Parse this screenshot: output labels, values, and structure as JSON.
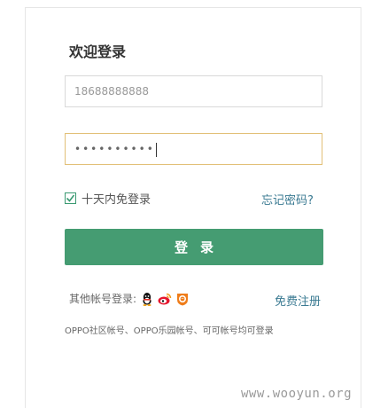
{
  "login": {
    "title": "欢迎登录",
    "phone_value": "18688888888",
    "password_mask": "••••••••••",
    "remember_label": "十天内免登录",
    "remember_checked": true,
    "forgot_label": "忘记密码?",
    "submit_label": "登录"
  },
  "social": {
    "label": "其他帐号登录:",
    "icons": [
      "qq-icon",
      "weibo-icon",
      "lion-badge-icon"
    ],
    "register_label": "免费注册"
  },
  "note": "OPPO社区帐号、OPPO乐园帐号、可可帐号均可登录",
  "watermark": "www.wooyun.org",
  "colors": {
    "accent": "#459c72",
    "link": "#3a7a92",
    "focus_border": "#e2c078"
  }
}
